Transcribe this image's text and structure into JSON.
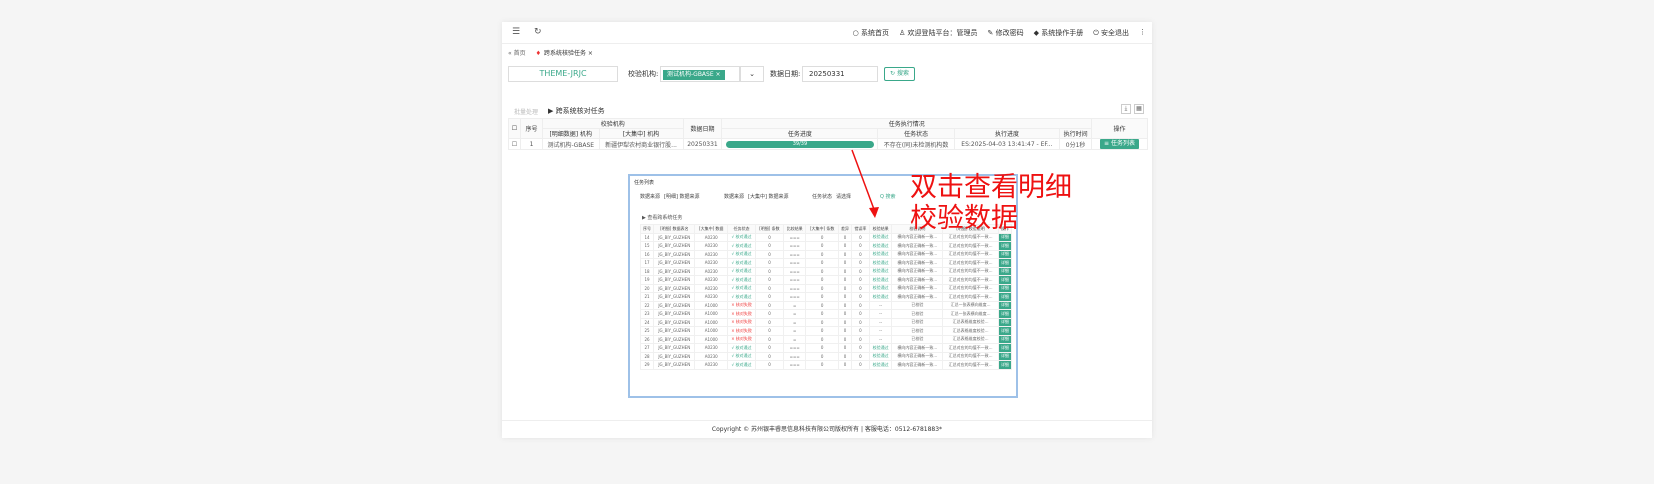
{
  "topbar": {
    "menu_icon": "menu-icon",
    "refresh_icon": "refresh-icon",
    "nav": [
      "系统首页",
      "欢迎登陆平台：管理员",
      "修改密码",
      "系统操作手册",
      "安全退出"
    ]
  },
  "tabs": {
    "home": "首页",
    "current": "跨系统核验任务"
  },
  "filters": {
    "project": "THEME-JRJC",
    "org_label": "校验机构:",
    "org_tag": "测试机构-GBASE",
    "date_label": "数据日期:",
    "date_value": "20250331",
    "search": "搜索"
  },
  "toolbar": {
    "disabled_btn": "批量处理",
    "title": "▶ 跨系统核对任务"
  },
  "table": {
    "group_org": "校验机构",
    "group_task": "任务执行情况",
    "headers": [
      "序号",
      "[明细数据] 机构",
      "[大集中] 机构",
      "数据日期",
      "任务进度",
      "任务状态",
      "执行进度",
      "执行时间",
      "操作"
    ],
    "rows": [
      {
        "no": "1",
        "org_a": "测试机构-GBASE",
        "org_b": "新疆伊犁农村商业银行股...",
        "date": "20250331",
        "progress": "39/39",
        "status": "不存在(同)未检测机构数",
        "exec": "ES:2025-04-03 13:41:47 - EF...",
        "time": "0分1秒",
        "action": "任务列表"
      }
    ]
  },
  "footer": "Copyright © 苏州银丰睿思信息科技有限公司版权所有 | 客服电话：0512-6781883*",
  "dialog": {
    "title": "任务列表",
    "f1_label": "数据来源",
    "f1_value": "[明细] 数据来源",
    "f2_label": "数据来源",
    "f2_value": "[大集中] 数据来源",
    "f3_label": "任务状态",
    "f3_value": "请选择",
    "search": "Q 搜索",
    "sub_title": "▶ 查看跨系统任务",
    "headers": [
      "序号",
      "[明细] 数据表名",
      "[大集中] 数据",
      "任务状态",
      "[明细] 条数",
      "比较结果",
      "[大集中] 条数",
      "差异",
      "错误率",
      "校验结果",
      "校验说明",
      "[明细] 校验说明",
      "操作"
    ],
    "rows": [
      [
        "14",
        "JG_BIY_GUZHEN",
        "A0230",
        "√ 核对通过",
        "0",
        "===",
        "0",
        "0",
        "0",
        "校验通过",
        "横向内容正确新一致...",
        "汇总对应的均值不一致...",
        "详细"
      ],
      [
        "15",
        "JG_BIY_GUZHEN",
        "A0230",
        "√ 核对通过",
        "0",
        "===",
        "0",
        "0",
        "0",
        "校验通过",
        "横向内容正确新一致...",
        "汇总对应的均值不一致...",
        "详细"
      ],
      [
        "16",
        "JG_BIY_GUZHEN",
        "A0230",
        "√ 核对通过",
        "0",
        "===",
        "0",
        "0",
        "0",
        "校验通过",
        "横向内容正确新一致...",
        "汇总对应的均值不一致...",
        "详细"
      ],
      [
        "17",
        "JG_BIY_GUZHEN",
        "A0230",
        "√ 核对通过",
        "0",
        "===",
        "0",
        "0",
        "0",
        "校验通过",
        "横向内容正确新一致...",
        "汇总对应的均值不一致...",
        "详细"
      ],
      [
        "18",
        "JG_BIY_GUZHEN",
        "A0230",
        "√ 核对通过",
        "0",
        "===",
        "0",
        "0",
        "0",
        "校验通过",
        "横向内容正确新一致...",
        "汇总对应的均值不一致...",
        "详细"
      ],
      [
        "19",
        "JG_BIY_GUZHEN",
        "A0230",
        "√ 核对通过",
        "0",
        "===",
        "0",
        "0",
        "0",
        "校验通过",
        "横向内容正确新一致...",
        "汇总对应的均值不一致...",
        "详细"
      ],
      [
        "20",
        "JG_BIY_GUZHEN",
        "A0230",
        "√ 核对通过",
        "0",
        "===",
        "0",
        "0",
        "0",
        "校验通过",
        "横向内容正确新一致...",
        "汇总对应的均值不一致...",
        "详细"
      ],
      [
        "21",
        "JG_BIY_GUZHEN",
        "A0230",
        "√ 核对通过",
        "0",
        "===",
        "0",
        "0",
        "0",
        "校验通过",
        "横向内容正确新一致...",
        "汇总对应的均值不一致...",
        "详细"
      ],
      [
        "22",
        "JG_BIY_GUZHEN",
        "A1000",
        "× 核对失败",
        "0",
        "=",
        "0",
        "0",
        "0",
        "--",
        "已校验",
        "汇总一张表横向维度...",
        "详细"
      ],
      [
        "23",
        "JG_BIY_GUZHEN",
        "A1000",
        "× 核对失败",
        "0",
        "=",
        "0",
        "0",
        "0",
        "--",
        "已校验",
        "汇总一张表横向维度...",
        "详细"
      ],
      [
        "24",
        "JG_BIY_GUZHEN",
        "A1000",
        "× 核对失败",
        "0",
        "=",
        "0",
        "0",
        "0",
        "--",
        "已校验",
        "汇总表格维度校验...",
        "详细"
      ],
      [
        "25",
        "JG_BIY_GUZHEN",
        "A1000",
        "× 核对失败",
        "0",
        "=",
        "0",
        "0",
        "0",
        "--",
        "已校验",
        "汇总表格维度校验...",
        "详细"
      ],
      [
        "26",
        "JG_BIY_GUZHEN",
        "A1000",
        "× 核对失败",
        "0",
        "=",
        "0",
        "0",
        "0",
        "--",
        "已校验",
        "汇总表格维度校验...",
        "详细"
      ],
      [
        "27",
        "JG_BIY_GUZHEN",
        "A0230",
        "√ 核对通过",
        "0",
        "===",
        "0",
        "0",
        "0",
        "校验通过",
        "横向内容正确新一致...",
        "汇总对应的均值不一致...",
        "详细"
      ],
      [
        "28",
        "JG_BIY_GUZHEN",
        "A0230",
        "√ 核对通过",
        "0",
        "===",
        "0",
        "0",
        "0",
        "校验通过",
        "横向内容正确新一致...",
        "汇总对应的均值不一致...",
        "详细"
      ],
      [
        "29",
        "JG_BIY_GUZHEN",
        "A0230",
        "√ 核对通过",
        "0",
        "===",
        "0",
        "0",
        "0",
        "校验通过",
        "横向内容正确新一致...",
        "汇总对应的均值不一致...",
        "详细"
      ]
    ]
  },
  "annotation": {
    "line1": "双击查看明细",
    "line2": "校验数据"
  },
  "colors": {
    "accent": "#3aa88a",
    "annotation": "#e11111",
    "dialog_border": "#9ec1e8"
  }
}
